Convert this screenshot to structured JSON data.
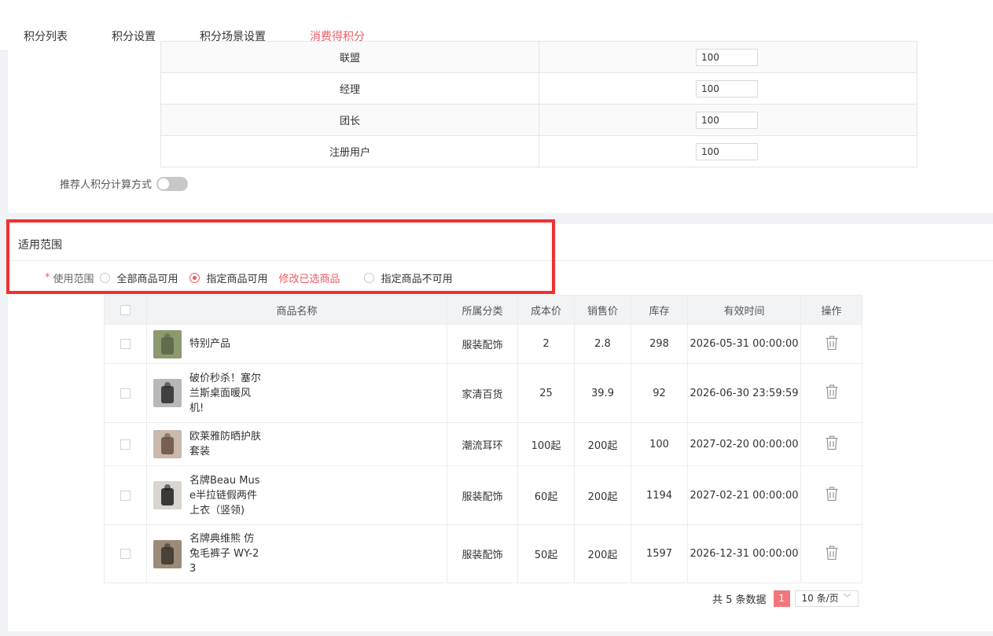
{
  "tabs": [
    {
      "label": "积分列表",
      "active": false
    },
    {
      "label": "积分设置",
      "active": false
    },
    {
      "label": "积分场景设置",
      "active": false
    },
    {
      "label": "消费得积分",
      "active": true
    }
  ],
  "roles": [
    {
      "name": "联盟",
      "value": "100"
    },
    {
      "name": "经理",
      "value": "100"
    },
    {
      "name": "团长",
      "value": "100"
    },
    {
      "name": "注册用户",
      "value": "100"
    }
  ],
  "referrer": {
    "label": "推荐人积分计算方式",
    "enabled": false
  },
  "scope": {
    "title": "适用范围",
    "required_mark": "*",
    "label": "使用范围",
    "options": [
      "全部商品可用",
      "指定商品可用",
      "指定商品不可用"
    ],
    "selected": 1,
    "modify_link": "修改已选商品"
  },
  "table": {
    "headers": [
      "商品名称",
      "所属分类",
      "成本价",
      "销售价",
      "库存",
      "有效时间",
      "操作"
    ],
    "rows": [
      {
        "name": "特别产品",
        "category": "服装配饰",
        "cost": "2",
        "price": "2.8",
        "stock": "298",
        "valid": "2026-05-31 00:00:00",
        "thumb_color": "#8d9a6f",
        "thumb_accent": "#5b6447"
      },
      {
        "name": "破价秒杀！塞尔兰斯桌面暖风机!",
        "category": "家清百货",
        "cost": "25",
        "price": "39.9",
        "stock": "92",
        "valid": "2026-06-30 23:59:59",
        "thumb_color": "#b8b8b8",
        "thumb_accent": "#2a2a2a"
      },
      {
        "name": "欧莱雅防晒护肤套装",
        "category": "潮流耳环",
        "cost": "100起",
        "price": "200起",
        "stock": "100",
        "valid": "2027-02-20 00:00:00",
        "thumb_color": "#c9b9ad",
        "thumb_accent": "#6a4f42"
      },
      {
        "name": "名牌Beau Muse半拉链假两件上衣（竖领)",
        "category": "服装配饰",
        "cost": "60起",
        "price": "200起",
        "stock": "1194",
        "valid": "2027-02-21 00:00:00",
        "thumb_color": "#d9d6d2",
        "thumb_accent": "#1d1d1d"
      },
      {
        "name": "名牌典维熊 仿兔毛裤子 WY-23",
        "category": "服装配饰",
        "cost": "50起",
        "price": "200起",
        "stock": "1597",
        "valid": "2026-12-31 00:00:00",
        "thumb_color": "#9b8b78",
        "thumb_accent": "#3c342c"
      }
    ]
  },
  "pager": {
    "total": "共 5 条数据",
    "current": "1",
    "page_size": "10 条/页"
  },
  "colors": {
    "accent": "#ea5c63",
    "highlight_border": "#f0302f",
    "header_bg": "#f2f3f5"
  },
  "icons": {
    "delete": "trash-icon",
    "dropdown": "chevron-down-icon"
  }
}
